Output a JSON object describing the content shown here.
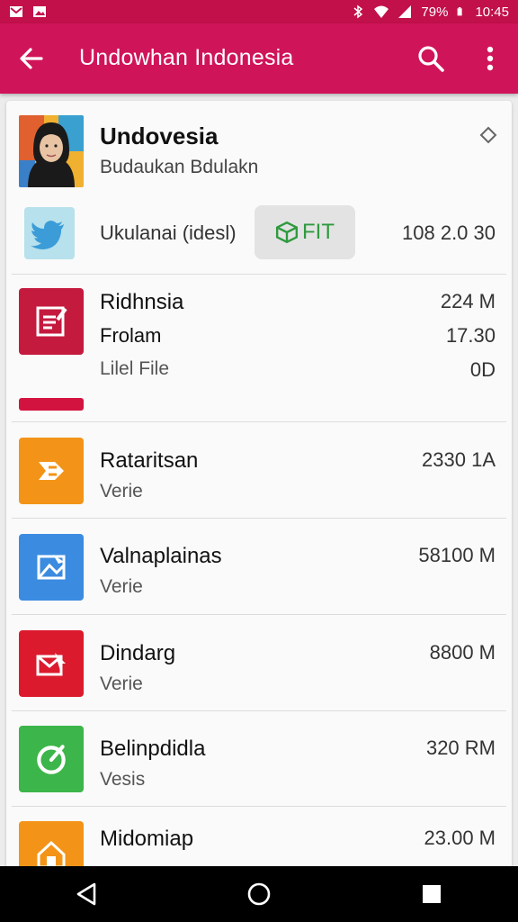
{
  "status_bar": {
    "battery_percent": "79%",
    "time": "10:45"
  },
  "app_bar": {
    "title": "Undowhan Indonesia"
  },
  "profile": {
    "name": "Undovesia",
    "subtitle": "Budaukan Bdulakn"
  },
  "twitter_row": {
    "label": "Ukulanai (idesl)",
    "button_label": "FIT",
    "value": "108 2.0 30"
  },
  "items": [
    {
      "icon": "document-edit-icon",
      "color": "#c41a3e",
      "title": "Ridhnsia",
      "line2": "Frolam",
      "line3": "Lilel File",
      "value1": "224 M",
      "value2": "17.30",
      "value3": "0D"
    },
    {
      "icon": "arrow-flag-icon",
      "color": "#f39418",
      "title": "Rataritsan",
      "line2": "Verie",
      "value1": "2330 1A"
    },
    {
      "icon": "image-mail-icon",
      "color": "#3b8be0",
      "title": "Valnaplainas",
      "line2": "Verie",
      "value1": "58100 M"
    },
    {
      "icon": "mail-arrow-icon",
      "color": "#dc1a2e",
      "title": "Dindarg",
      "line2": "Verie",
      "value1": "8800 M"
    },
    {
      "icon": "check-circle-icon",
      "color": "#3cb54a",
      "title": "Belinpdidla",
      "line2": "Vesis",
      "value1": "320 RM"
    },
    {
      "icon": "house-icon",
      "color": "#f39418",
      "title": "Midomiap",
      "value1": "23.00 M"
    }
  ]
}
